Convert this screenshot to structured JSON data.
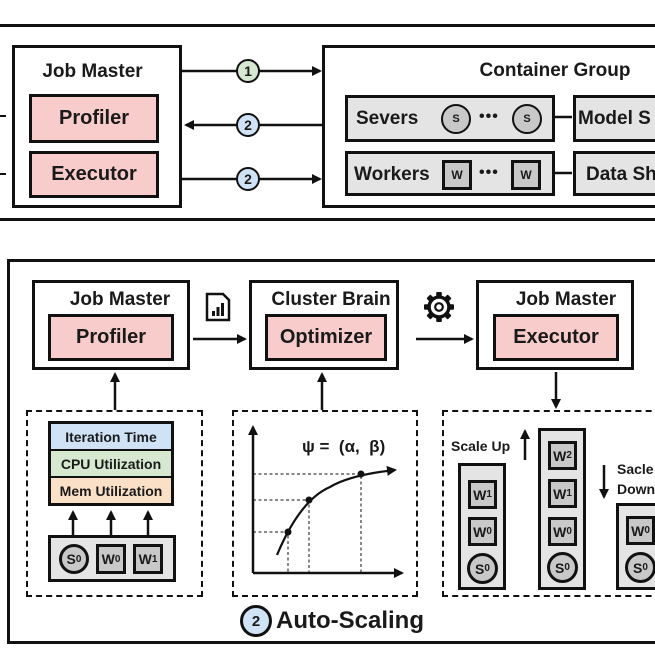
{
  "colors": {
    "component_fill": "#f9cccc",
    "container_fill": "#e4e4e4",
    "step1_badge": "#d6e8d0",
    "step2_badge": "#cfe2f6",
    "iteration_time_fill": "#cfe2f6",
    "cpu_util_fill": "#d6e8d0",
    "mem_util_fill": "#fbe0c8",
    "node_fill": "#c8c8c8"
  },
  "top_panel": {
    "job_master": {
      "title": "Job Master",
      "profiler": "Profiler",
      "executor": "Executor"
    },
    "arrows": [
      {
        "badge": "1",
        "direction": "right"
      },
      {
        "badge": "2",
        "direction": "left"
      },
      {
        "badge": "2",
        "direction": "right"
      }
    ],
    "container_group": {
      "title": "Container Group",
      "servers_label": "Severs",
      "server_node": "S",
      "workers_label": "Workers",
      "worker_node": "W",
      "ellipsis": "•••",
      "model_shard_label": "Model S",
      "data_shard_label": "Data Sh"
    }
  },
  "bottom_panel": {
    "caption_badge": "2",
    "caption": "Auto-Scaling",
    "job_master_1": {
      "title": "Job Master",
      "component": "Profiler"
    },
    "cluster_brain": {
      "title": "Cluster Brain",
      "component": "Optimizer"
    },
    "job_master_2": {
      "title": "Job Master",
      "component": "Executor"
    },
    "icons": {
      "report": "report-chart-icon",
      "settings": "gear-icon"
    },
    "metrics": [
      "Iteration Time",
      "CPU Utilization",
      "Mem Utilization"
    ],
    "profiled_nodes": [
      {
        "base": "S",
        "sub": "0",
        "shape": "circle"
      },
      {
        "base": "W",
        "sub": "0",
        "shape": "square"
      },
      {
        "base": "W",
        "sub": "1",
        "shape": "square"
      }
    ],
    "optimizer_formula": "ψ =  (α,  β)",
    "scaling": {
      "scale_up_label": "Scale Up",
      "scale_down_label_1": "Sacle",
      "scale_down_label_2": "Down",
      "before": [
        {
          "base": "W",
          "sub": "1",
          "shape": "square"
        },
        {
          "base": "W",
          "sub": "0",
          "shape": "square"
        },
        {
          "base": "S",
          "sub": "0",
          "shape": "circle"
        }
      ],
      "scaled_up": [
        {
          "base": "W",
          "sub": "2",
          "shape": "square"
        },
        {
          "base": "W",
          "sub": "1",
          "shape": "square"
        },
        {
          "base": "W",
          "sub": "0",
          "shape": "square"
        },
        {
          "base": "S",
          "sub": "0",
          "shape": "circle"
        }
      ],
      "scaled_down": [
        {
          "base": "W",
          "sub": "0",
          "shape": "square"
        },
        {
          "base": "S",
          "sub": "0",
          "shape": "circle"
        }
      ]
    }
  }
}
